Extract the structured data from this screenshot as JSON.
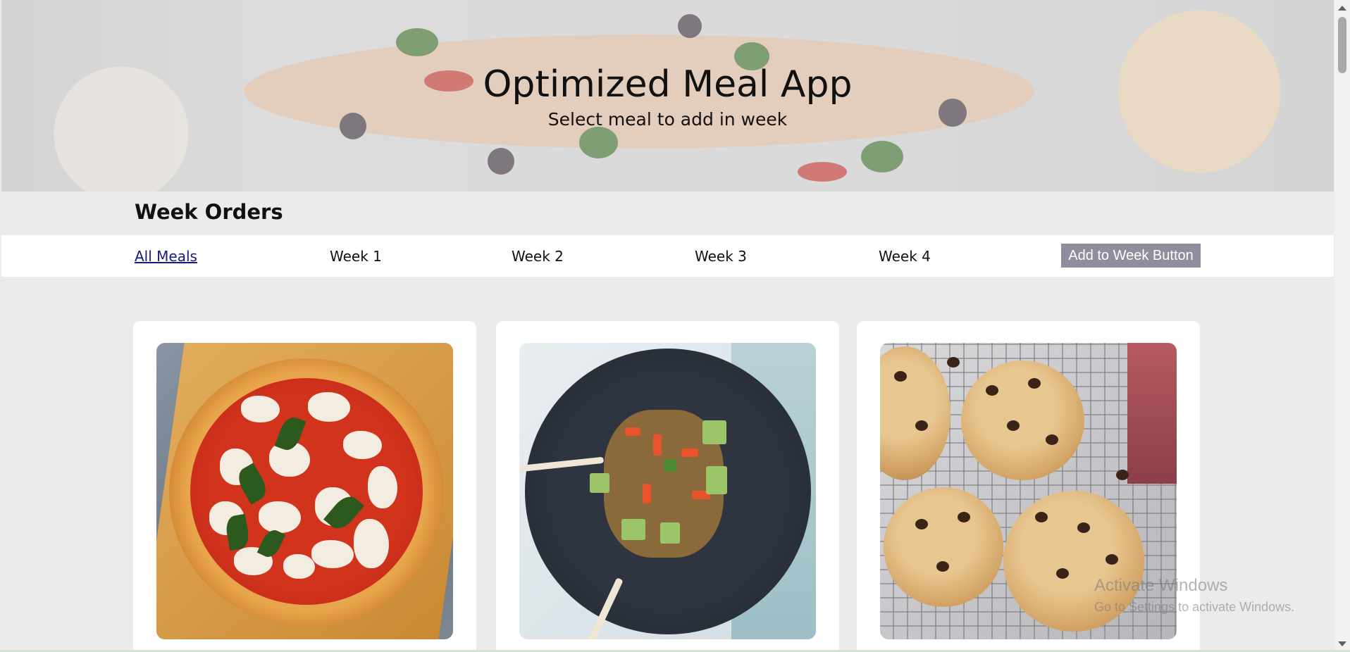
{
  "header": {
    "title": "Optimized Meal App",
    "subtitle": "Select meal to add in week"
  },
  "orders": {
    "heading": "Week Orders"
  },
  "nav": {
    "items": [
      {
        "label": "All Meals",
        "active": true
      },
      {
        "label": "Week 1",
        "active": false
      },
      {
        "label": "Week 2",
        "active": false
      },
      {
        "label": "Week 3",
        "active": false
      },
      {
        "label": "Week 4",
        "active": false
      }
    ],
    "add_button_label": "Add to Week Button"
  },
  "meals": [
    {
      "image": "pizza-margherita-photo"
    },
    {
      "image": "stir-fry-rice-bowl-photo"
    },
    {
      "image": "chocolate-chip-cookies-photo"
    }
  ],
  "watermark": {
    "title": "Activate Windows",
    "subtitle": "Go to Settings to activate Windows."
  },
  "colors": {
    "background": "#ebebeb",
    "navbar": "#ffffff",
    "add_button": "#8e8e9e",
    "active_link": "#1a1a7a"
  }
}
